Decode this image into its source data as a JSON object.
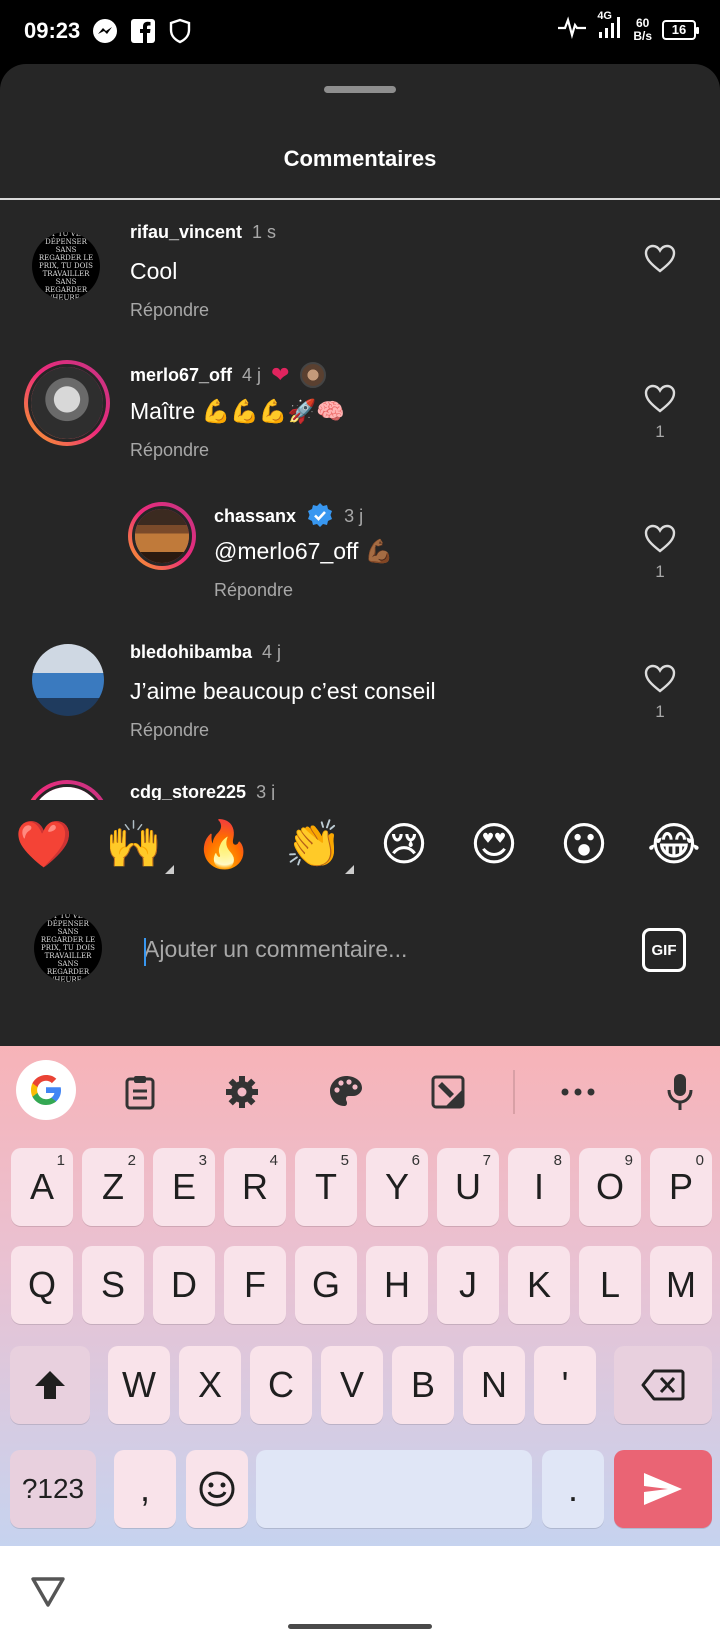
{
  "status_bar": {
    "time": "09:23",
    "network": "4G",
    "speed_value": "60",
    "speed_unit": "B/s",
    "battery": "16"
  },
  "sheet": {
    "title": "Commentaires"
  },
  "comments": [
    {
      "user": "rifau_vincent",
      "time": "1 s",
      "text": "Cool",
      "reply": "Répondre",
      "likes": "",
      "avatar_text": "« $1 TU VEUX DÉPENSER SANS REGARDER LE PRIX, TU DOIS TRAVAILLER SANS REGARDER L'HEURE »"
    },
    {
      "user": "merlo67_off",
      "time": "4 j",
      "text": "Maître 💪💪💪🚀🧠",
      "reply": "Répondre",
      "likes": "1"
    },
    {
      "user": "chassanx",
      "time": "3 j",
      "text": "@merlo67_off 💪🏾",
      "reply": "Répondre",
      "likes": "1"
    },
    {
      "user": "bledohibamba",
      "time": "4 j",
      "text": "J’aime beaucoup c’est conseil",
      "reply": "Répondre",
      "likes": "1"
    },
    {
      "user": "cdg_store225",
      "time": "3 j"
    }
  ],
  "emoji_bar": [
    "❤️",
    "🙌",
    "🔥",
    "👏",
    "😢",
    "😍",
    "😮",
    "😂"
  ],
  "composer": {
    "placeholder": "Ajouter un commentaire...",
    "gif_label": "GIF",
    "avatar_text": "« $1 TU VEUX DÉPENSER SANS REGARDER LE PRIX, TU DOIS TRAVAILLER SANS REGARDER L'HEURE »"
  },
  "keyboard": {
    "row1": [
      {
        "k": "A",
        "h": "1"
      },
      {
        "k": "Z",
        "h": "2"
      },
      {
        "k": "E",
        "h": "3"
      },
      {
        "k": "R",
        "h": "4"
      },
      {
        "k": "T",
        "h": "5"
      },
      {
        "k": "Y",
        "h": "6"
      },
      {
        "k": "U",
        "h": "7"
      },
      {
        "k": "I",
        "h": "8"
      },
      {
        "k": "O",
        "h": "9"
      },
      {
        "k": "P",
        "h": "0"
      }
    ],
    "row2": [
      "Q",
      "S",
      "D",
      "F",
      "G",
      "H",
      "J",
      "K",
      "L",
      "M"
    ],
    "row3": [
      "W",
      "X",
      "C",
      "V",
      "B",
      "N",
      "'"
    ],
    "symbols_key": "?123",
    "comma_key": ",",
    "period_key": "."
  },
  "colors": {
    "sheet_bg": "#262626",
    "send_key": "#ea6474",
    "like_heart": "#e0245e"
  }
}
